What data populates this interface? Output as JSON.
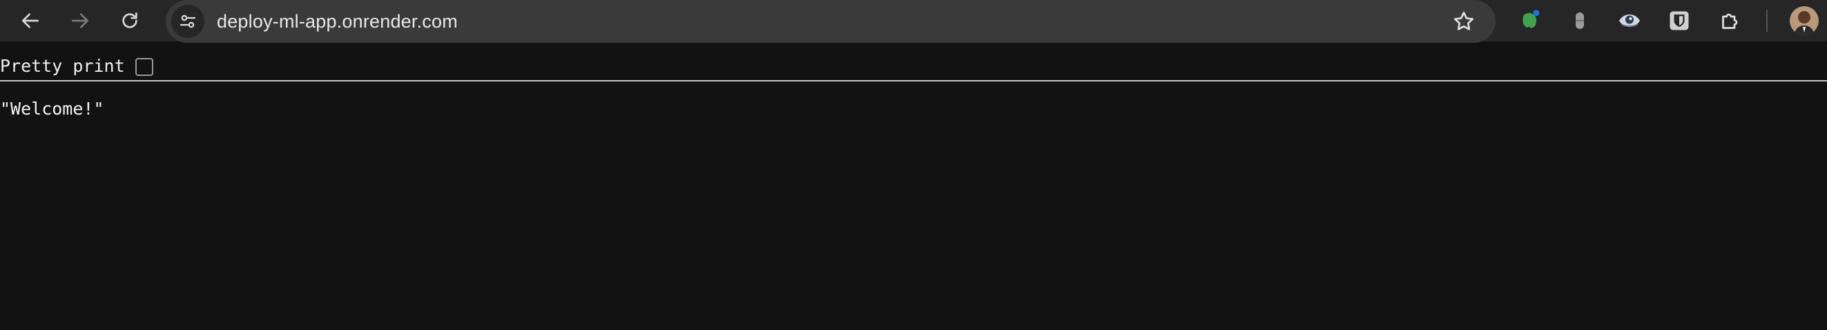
{
  "browser": {
    "url": "deploy-ml-app.onrender.com",
    "icons": {
      "back": "back-arrow-icon",
      "forward": "forward-arrow-icon",
      "reload": "reload-icon",
      "site_info": "site-info-tune-icon",
      "bookmark": "star-icon",
      "extensions": "puzzle-icon"
    },
    "extensions": [
      {
        "name": "evernote-extension",
        "icon": "elephant-icon",
        "color": "#3fa34d"
      },
      {
        "name": "grey-capsule-extension",
        "icon": "capsule-icon",
        "color": "#9a9a9a"
      },
      {
        "name": "eye-extension",
        "icon": "eye-icon",
        "color": "#cfd8e3"
      },
      {
        "name": "bitwarden-extension",
        "icon": "shield-icon",
        "color": "#d0d0d0"
      }
    ]
  },
  "viewer": {
    "pretty_print_label": "Pretty print",
    "pretty_print_checked": false,
    "content": "\"Welcome!\""
  },
  "colors": {
    "toolbar_bg": "#262626",
    "omnibox_bg": "#3a3a3a",
    "page_bg": "#121212",
    "text": "#f0f0f0"
  }
}
